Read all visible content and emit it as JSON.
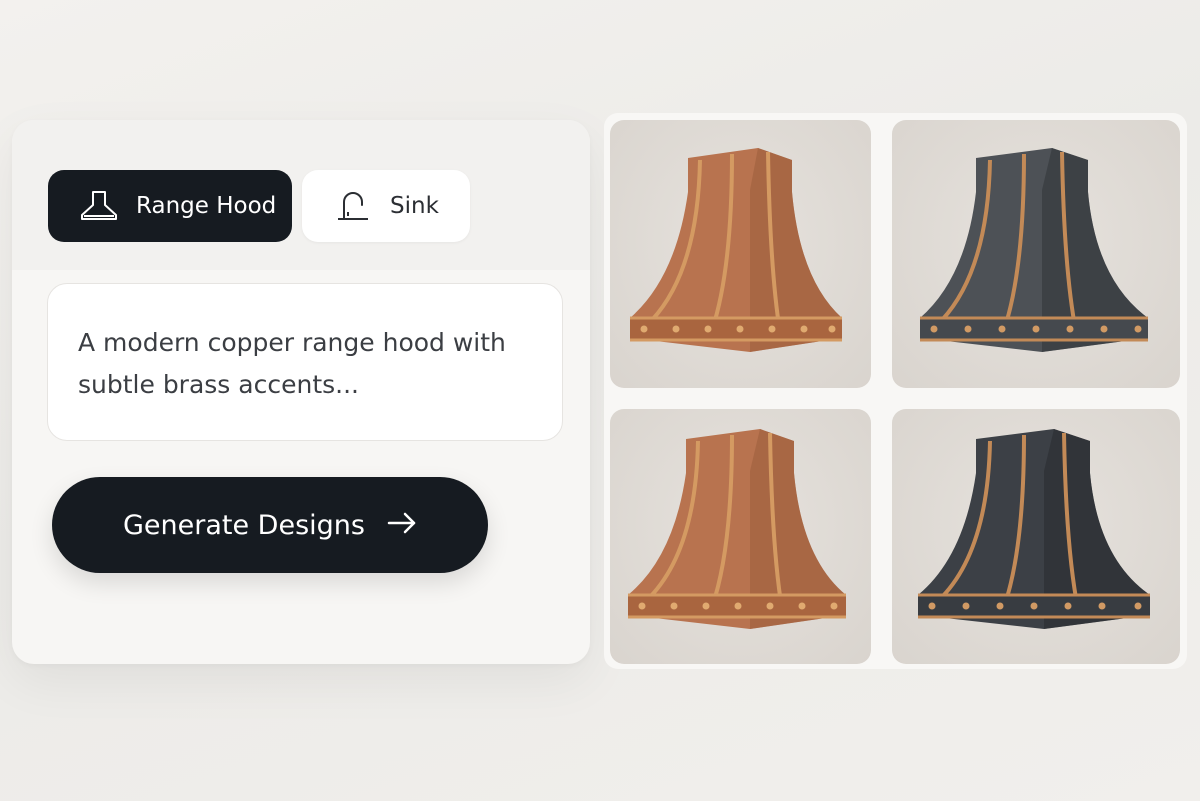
{
  "tabs": [
    {
      "label": "Range Hood",
      "icon": "range-hood-icon",
      "active": true
    },
    {
      "label": "Sink",
      "icon": "faucet-icon",
      "active": false
    }
  ],
  "prompt": {
    "text": "A modern copper range hood with subtle brass accents..."
  },
  "generate_button": {
    "label": "Generate Designs",
    "icon": "arrow-right-icon"
  },
  "results": [
    {
      "finish": "copper",
      "body": "#b8734f",
      "trim": "#d49a62"
    },
    {
      "finish": "dark steel",
      "body": "#4d5156",
      "trim": "#c38a57"
    },
    {
      "finish": "copper",
      "body": "#b8734f",
      "trim": "#d49a62"
    },
    {
      "finish": "dark steel",
      "body": "#3c4046",
      "trim": "#c38a57"
    }
  ],
  "colors": {
    "dark": "#161b21",
    "panel": "#f7f6f4",
    "accent_copper": "#b8734f"
  }
}
